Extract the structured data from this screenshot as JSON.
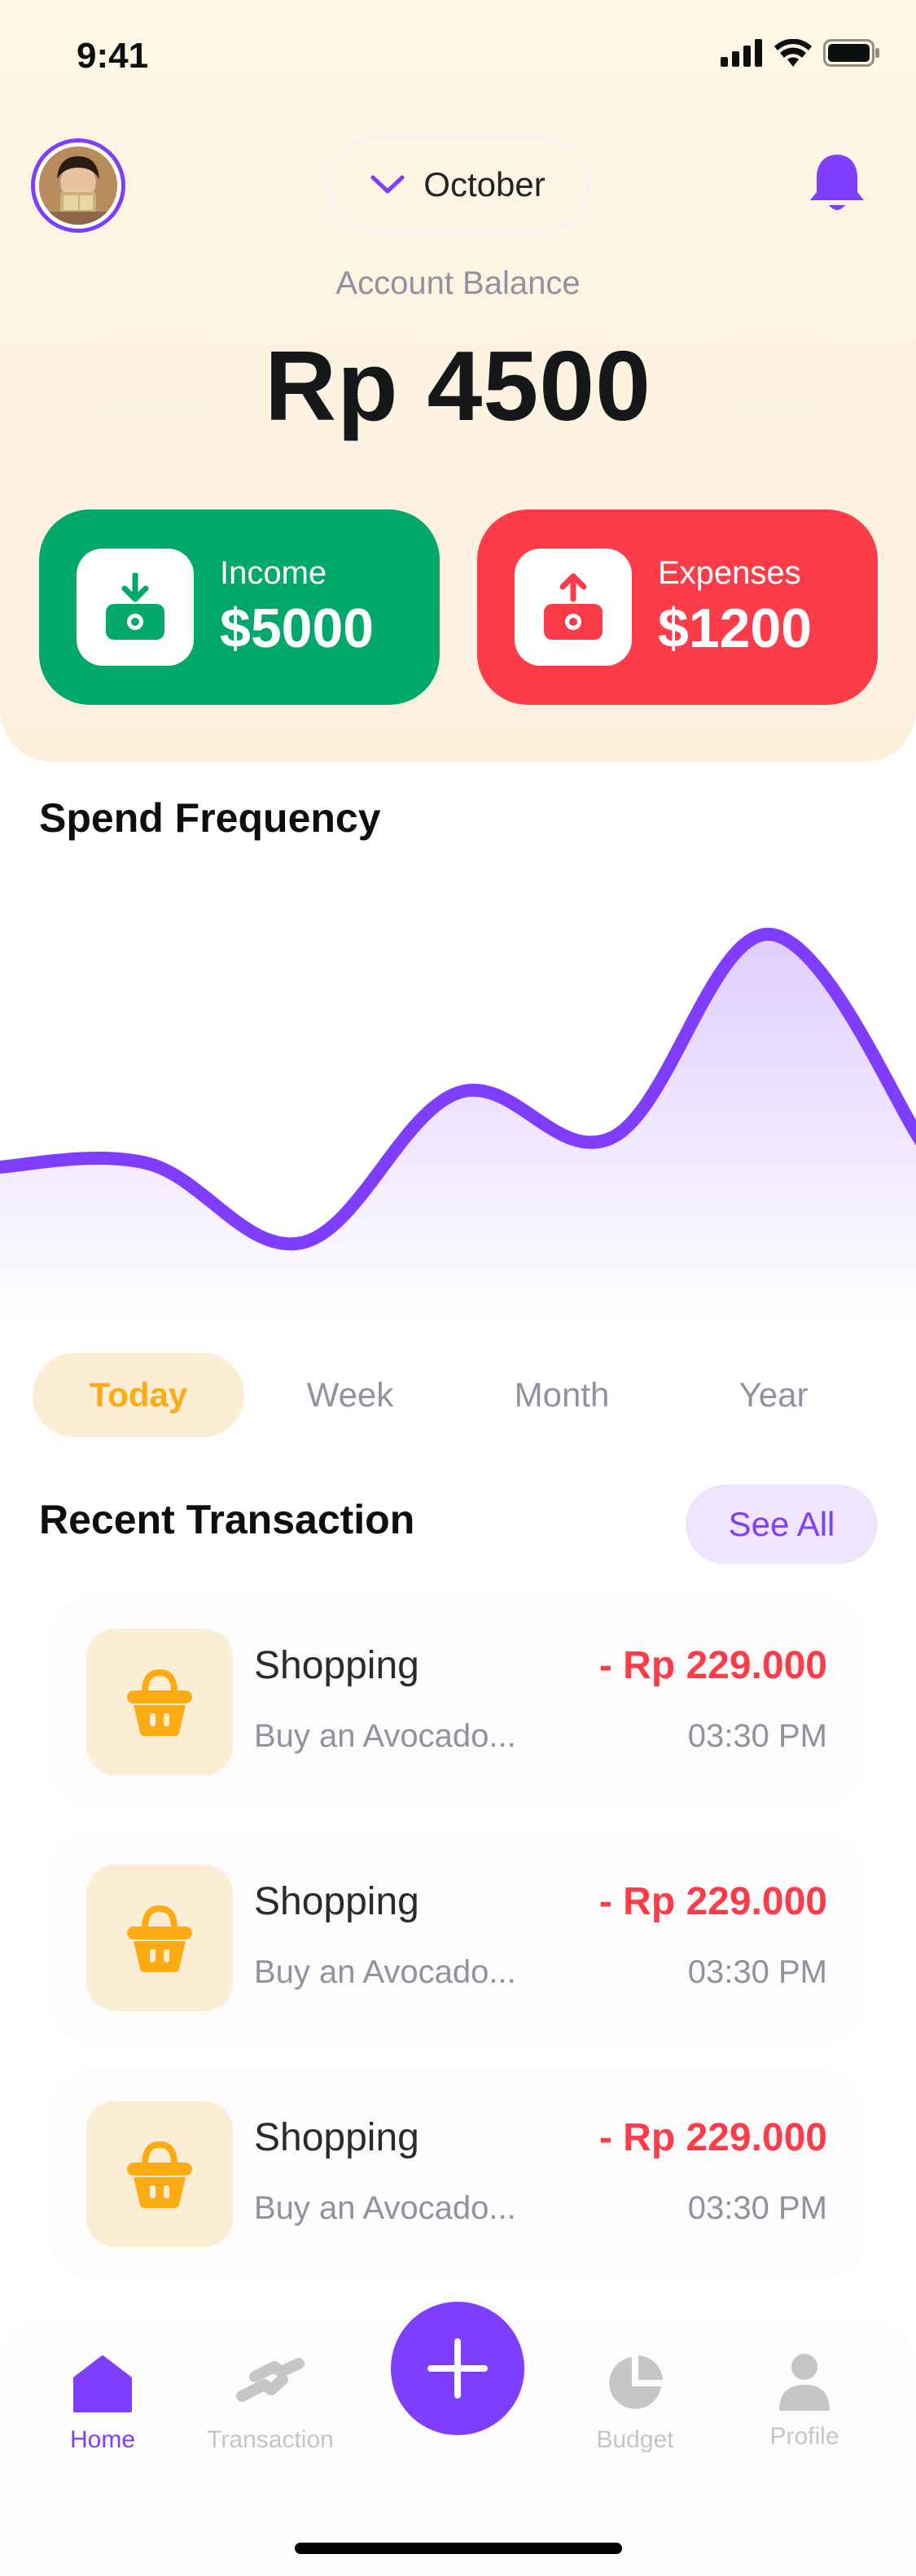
{
  "status_bar": {
    "time": "9:41"
  },
  "header": {
    "month": "October",
    "balance_label": "Account Balance",
    "balance_value": "Rp 4500"
  },
  "cards": {
    "income": {
      "label": "Income",
      "amount": "$5000"
    },
    "expense": {
      "label": "Expenses",
      "amount": "$1200"
    }
  },
  "spend_frequency": {
    "title": "Spend Frequency",
    "periods": [
      "Today",
      "Week",
      "Month",
      "Year"
    ],
    "active_period": "Today"
  },
  "chart_data": {
    "type": "area",
    "title": "Spend Frequency",
    "values": [
      25,
      26,
      8,
      42,
      32,
      78,
      30
    ]
  },
  "recent": {
    "title": "Recent Transaction",
    "see_all": "See All",
    "items": [
      {
        "title": "Shopping",
        "description": "Buy an Avocado...",
        "amount": "- Rp 229.000",
        "time": "03:30 PM",
        "icon": "shopping-basket-icon"
      },
      {
        "title": "Shopping",
        "description": "Buy an Avocado...",
        "amount": "- Rp 229.000",
        "time": "03:30 PM",
        "icon": "shopping-basket-icon"
      },
      {
        "title": "Shopping",
        "description": "Buy an Avocado...",
        "amount": "- Rp 229.000",
        "time": "03:30 PM",
        "icon": "shopping-basket-icon"
      }
    ]
  },
  "nav": {
    "home": "Home",
    "transaction": "Transaction",
    "budget": "Budget",
    "profile": "Profile"
  },
  "colors": {
    "primary": "#7F3DFF",
    "income": "#00A86B",
    "expense": "#FD3C4A",
    "shopping": "#FCAC12"
  }
}
